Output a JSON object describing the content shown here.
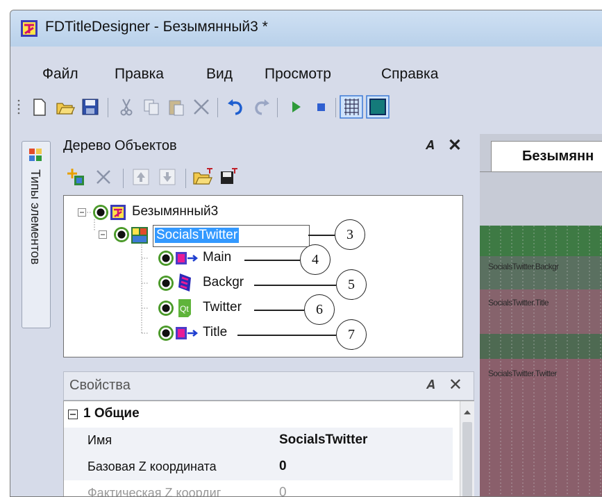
{
  "window": {
    "title": "FDTitleDesigner - Безымянный3 *"
  },
  "menu": [
    {
      "label": "Файл"
    },
    {
      "label": "Правка"
    },
    {
      "label": "Вид"
    },
    {
      "label": "Просмотр"
    },
    {
      "label": "Справка"
    }
  ],
  "toolbar_icons": [
    "new-icon",
    "open-icon",
    "save-icon",
    "cut-icon",
    "copy-icon",
    "paste-icon",
    "delete-icon",
    "undo-icon",
    "redo-icon",
    "play-icon",
    "stop-icon",
    "grid-icon",
    "background-icon"
  ],
  "side_tab": {
    "label": "Типы элементов"
  },
  "tree_panel": {
    "title": "Дерево Объектов",
    "pin": "ᵽ",
    "close": "✕",
    "root": {
      "label": "Безымянный3"
    },
    "group": {
      "label": "SocialsTwitter"
    },
    "children": [
      {
        "label": "Main",
        "icon": "title-icon"
      },
      {
        "label": "Backgr",
        "icon": "film-icon"
      },
      {
        "label": "Twitter",
        "icon": "qt-icon"
      },
      {
        "label": "Title",
        "icon": "title-icon"
      }
    ],
    "callouts": [
      "3",
      "4",
      "5",
      "6",
      "7"
    ]
  },
  "props_panel": {
    "title": "Свойства",
    "section": "1 Общие",
    "rows": [
      {
        "name": "Имя",
        "value": "SocialsTwitter"
      },
      {
        "name": "Базовая Z координата",
        "value": "0"
      },
      {
        "name": "Фактическая Z коордиг",
        "value": "0"
      }
    ]
  },
  "document": {
    "tab_label": "Безымянн",
    "canvas_labels": [
      "SocialsTwitter.Backgr",
      "SocialsTwitter.Title",
      "SocialsTwitter.Twitter"
    ]
  },
  "colors": {
    "selection": "#3399ff",
    "window_bg": "#d6dbe9",
    "canvas": "#8a5f6b",
    "green_band": "#3e7a44"
  }
}
